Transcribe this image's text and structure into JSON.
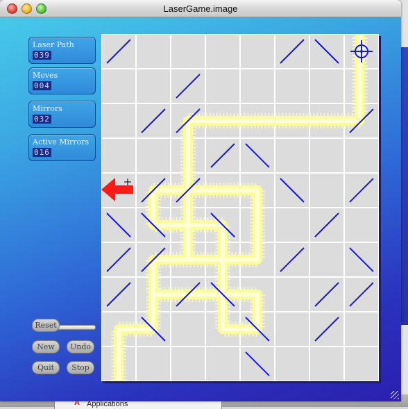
{
  "window": {
    "title": "LaserGame.image"
  },
  "counters": [
    {
      "label": "Laser Path",
      "value": "039"
    },
    {
      "label": "Moves",
      "value": "004"
    },
    {
      "label": "Mirrors",
      "value": "032"
    },
    {
      "label": "Active Mirrors",
      "value": "016"
    }
  ],
  "buttons": {
    "reset": "Reset",
    "new": "New",
    "undo": "Undo",
    "quit": "Quit",
    "stop": "Stop"
  },
  "board": {
    "cols": 8,
    "rows": 10,
    "mirrors": [
      [
        0,
        0,
        "/"
      ],
      [
        5,
        0,
        "/"
      ],
      [
        6,
        0,
        "\\"
      ],
      [
        2,
        1,
        "/"
      ],
      [
        1,
        2,
        "/"
      ],
      [
        2,
        2,
        "/"
      ],
      [
        7,
        2,
        "/"
      ],
      [
        3,
        3,
        "/"
      ],
      [
        4,
        3,
        "\\"
      ],
      [
        1,
        4,
        "/"
      ],
      [
        2,
        4,
        "/"
      ],
      [
        5,
        4,
        "\\"
      ],
      [
        7,
        4,
        "/"
      ],
      [
        0,
        5,
        "\\"
      ],
      [
        1,
        5,
        "\\"
      ],
      [
        3,
        5,
        "\\"
      ],
      [
        6,
        5,
        "/"
      ],
      [
        0,
        6,
        "/"
      ],
      [
        1,
        6,
        "/"
      ],
      [
        5,
        6,
        "/"
      ],
      [
        7,
        6,
        "\\"
      ],
      [
        0,
        7,
        "/"
      ],
      [
        2,
        7,
        "/"
      ],
      [
        3,
        7,
        "\\"
      ],
      [
        6,
        7,
        "/"
      ],
      [
        7,
        7,
        "/"
      ],
      [
        1,
        8,
        "\\"
      ],
      [
        4,
        8,
        "\\"
      ],
      [
        6,
        8,
        "/"
      ],
      [
        4,
        9,
        "\\"
      ]
    ],
    "laser_path": [
      [
        7.45,
        0
      ],
      [
        7.45,
        2.5
      ],
      [
        2.5,
        2.5
      ],
      [
        2.5,
        4.5
      ],
      [
        1.5,
        4.5
      ],
      [
        1.5,
        5.5
      ],
      [
        3.5,
        5.5
      ],
      [
        3.5,
        7.5
      ],
      [
        1.5,
        7.5
      ],
      [
        1.5,
        6.5
      ],
      [
        4.5,
        6.5
      ],
      [
        4.5,
        4.5
      ],
      [
        2.5,
        4.5
      ],
      [
        2.5,
        6.5
      ],
      [
        3.5,
        6.5
      ],
      [
        3.5,
        8.5
      ],
      [
        4.5,
        8.5
      ],
      [
        4.5,
        7.5
      ],
      [
        1.5,
        7.5
      ],
      [
        1.5,
        8.5
      ],
      [
        0.5,
        8.5
      ],
      [
        0.5,
        10
      ]
    ],
    "target_cell": [
      7,
      0
    ],
    "arrow_row": 4,
    "colors": {
      "cell": "#dcdcdc",
      "grid": "#ffffff",
      "mirror": "#1a1ad0",
      "laser": "#fbfb9a",
      "laser_glow": "#f8f8c8",
      "arrow": "#ff1a1a",
      "target": "#1a1ad0"
    }
  },
  "desktop": {
    "taskbar_label": "Applications"
  }
}
